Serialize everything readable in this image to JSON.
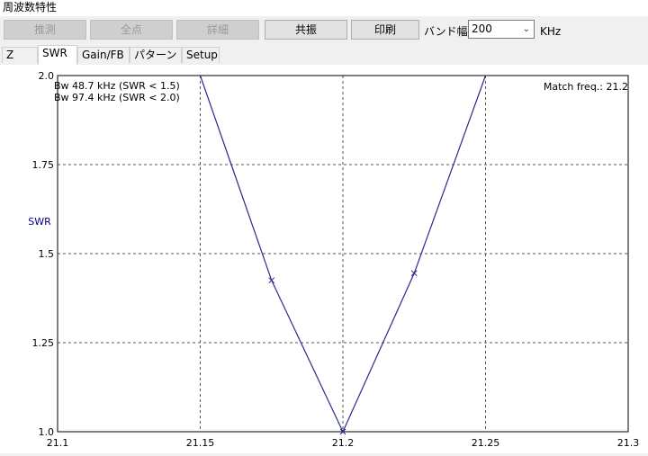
{
  "window": {
    "title": "周波数特性"
  },
  "toolbar": {
    "buttons": [
      {
        "label": "推測",
        "enabled": false
      },
      {
        "label": "全点",
        "enabled": false
      },
      {
        "label": "詳細",
        "enabled": false
      },
      {
        "label": "共振",
        "enabled": true
      },
      {
        "label": "印刷",
        "enabled": true
      }
    ],
    "band_label": "バンド幅",
    "band_value": "200",
    "band_unit": "KHz"
  },
  "tabs": [
    {
      "label": "Z",
      "active": false
    },
    {
      "label": "SWR",
      "active": true
    },
    {
      "label": "Gain/FB",
      "active": false
    },
    {
      "label": "パターン",
      "active": false
    },
    {
      "label": "Setup",
      "active": false
    }
  ],
  "chart_data": {
    "type": "line",
    "ylabel": "SWR",
    "xlim": [
      21.1,
      21.3
    ],
    "ylim": [
      1.0,
      2.0
    ],
    "x_ticks": [
      "21.1",
      "21.15",
      "21.2",
      "21.25",
      "21.3"
    ],
    "y_ticks": [
      "1.0",
      "1.25",
      "1.5",
      "1.75",
      "2.0"
    ],
    "grid": true,
    "line_color": "#2a2a8c",
    "series": [
      {
        "x": [
          21.15,
          21.175,
          21.2,
          21.225,
          21.25
        ],
        "y": [
          2.0,
          1.425,
          1.0,
          1.445,
          2.0
        ]
      }
    ],
    "markers": [
      {
        "x": 21.175,
        "y": 1.425
      },
      {
        "x": 21.225,
        "y": 1.445
      }
    ],
    "annotations": {
      "bw1": "Bw 48.7 kHz (SWR < 1.5)",
      "bw2": "Bw 97.4 kHz (SWR < 2.0)",
      "match": "Match freq.: 21.2"
    }
  }
}
